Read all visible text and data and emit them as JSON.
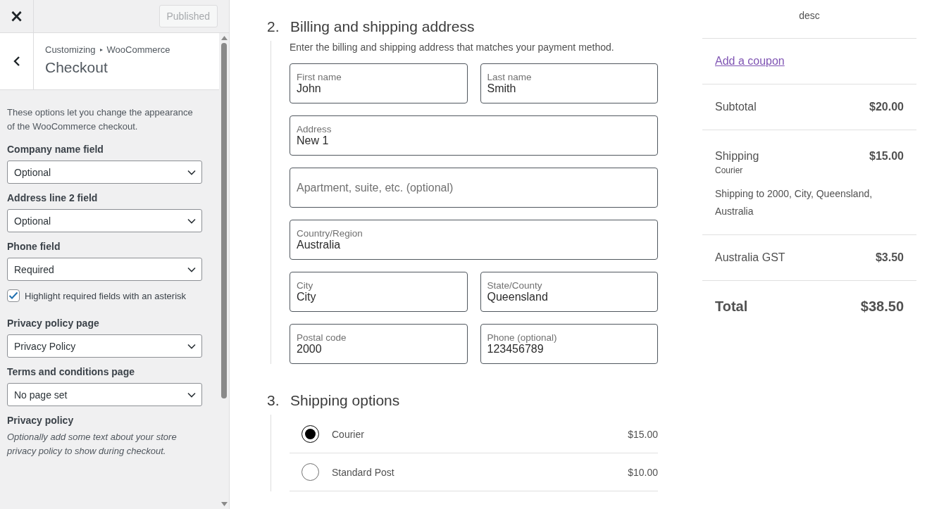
{
  "customizer": {
    "close": "×",
    "publish_button": {
      "label": "Published",
      "disabled": true
    },
    "breadcrumb": {
      "parent": "Customizing",
      "separator": "▸",
      "child": "WooCommerce"
    },
    "title": "Checkout",
    "description": "These options let you change the appearance of the WooCommerce checkout.",
    "controls": [
      {
        "kind": "select",
        "label": "Company name field",
        "value": "Optional"
      },
      {
        "kind": "select",
        "label": "Address line 2 field",
        "value": "Optional"
      },
      {
        "kind": "select",
        "label": "Phone field",
        "value": "Required"
      },
      {
        "kind": "checkbox",
        "label": "Highlight required fields with an asterisk",
        "checked": true
      },
      {
        "kind": "select",
        "label": "Privacy policy page",
        "value": "Privacy Policy"
      },
      {
        "kind": "select",
        "label": "Terms and conditions page",
        "value": "No page set"
      },
      {
        "kind": "note",
        "label": "Privacy policy",
        "value": "Optionally add some text about your store privacy policy to show during checkout."
      }
    ]
  },
  "billing": {
    "number": "2.",
    "title": "Billing and shipping address",
    "description": "Enter the billing and shipping address that matches your payment method.",
    "rows": [
      [
        {
          "label": "First name",
          "value": "John"
        },
        {
          "label": "Last name",
          "value": "Smith"
        }
      ],
      [
        {
          "label": "Address",
          "value": "New 1"
        }
      ],
      [
        {
          "placeholder": "Apartment, suite, etc. (optional)"
        }
      ],
      [
        {
          "label": "Country/Region",
          "value": "Australia"
        }
      ],
      [
        {
          "label": "City",
          "value": "City"
        },
        {
          "label": "State/County",
          "value": "Queensland"
        }
      ],
      [
        {
          "label": "Postal code",
          "value": "2000"
        },
        {
          "label": "Phone (optional)",
          "value": "123456789"
        }
      ]
    ]
  },
  "shipping": {
    "number": "3.",
    "title": "Shipping options",
    "options": [
      {
        "label": "Courier",
        "price": "$15.00",
        "selected": true
      },
      {
        "label": "Standard Post",
        "price": "$10.00",
        "selected": false
      }
    ]
  },
  "summary": {
    "description": "desc",
    "coupon_link": "Add a coupon",
    "rows": [
      {
        "kind": "line",
        "label": "Subtotal",
        "amount": "$20.00"
      },
      {
        "kind": "shipping",
        "label": "Shipping",
        "amount": "$15.00",
        "method": "Courier",
        "note": "Shipping to 2000, City, Queensland, Australia"
      },
      {
        "kind": "line",
        "label": "Australia GST",
        "amount": "$3.50"
      },
      {
        "kind": "total",
        "label": "Total",
        "amount": "$38.50"
      }
    ]
  }
}
